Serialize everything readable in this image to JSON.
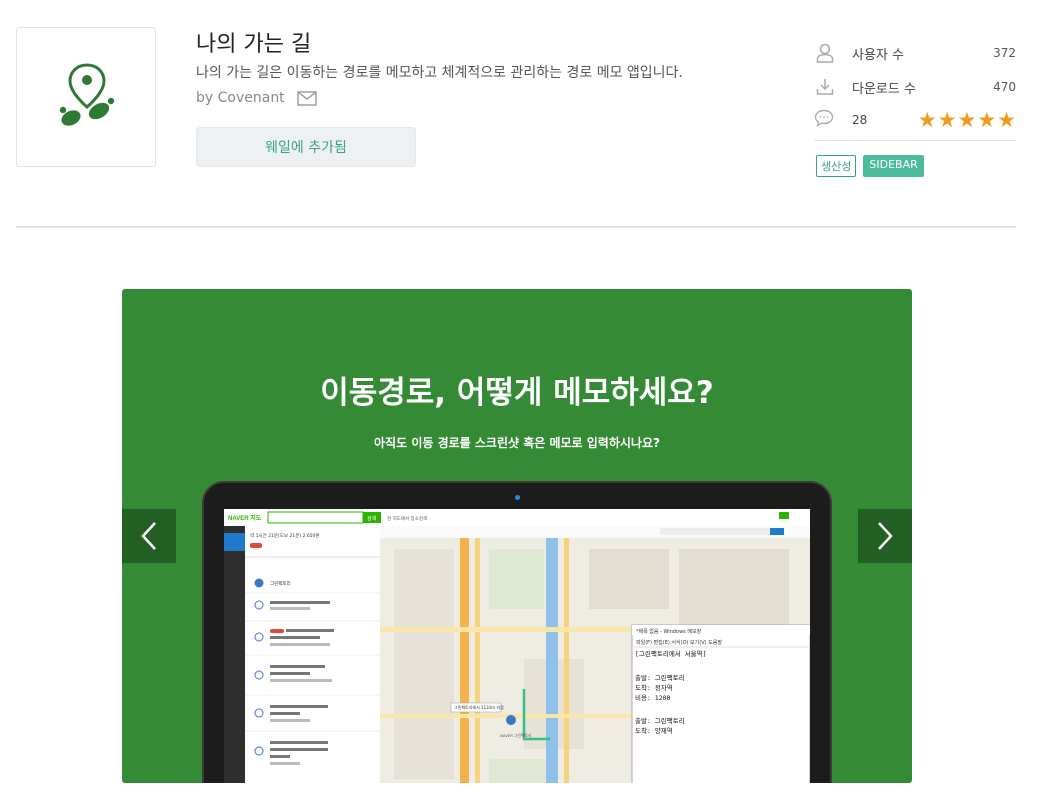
{
  "app": {
    "title": "나의 가는 길",
    "description": "나의 가는 길은 이동하는 경로를 메모하고 체계적으로 관리하는 경로 메모 앱입니다.",
    "author": "by Covenant",
    "add_button": "웨일에 추가됨"
  },
  "stats": {
    "users_label": "사용자 수",
    "users_value": "372",
    "downloads_label": "다운로드 수",
    "downloads_value": "470",
    "reviews_count": "28",
    "rating": 5
  },
  "tags": [
    "생산성",
    "SIDEBAR"
  ],
  "slide": {
    "headline": "이동경로, 어떻게 메모하세요?",
    "subtitle": "아직도 이동 경로를 스크린샷 혹은 메모로 입력하시나요?"
  },
  "screen": {
    "map_logo": "NAVER 지도",
    "search_btn": "검색",
    "search_hint": "현 지도에서 장소검색",
    "summary": "약 1시간 21분(도보 21분) 2,650원",
    "route_start": "그린팩토리",
    "notepad_title": "*제목 없음 - Windows 메모장",
    "notepad_menu": "파일(F)  편집(E)  서식(O)  보기(V)  도움말",
    "notepad_lines": [
      "[그린팩토리에서 서울역]",
      "",
      "출발: 그린팩토리",
      "도착: 정자역",
      "비용: 1200",
      "",
      "출발: 그린팩토리",
      "도착: 양재역"
    ],
    "map_label": "그린팩토리에서 1133m 지점",
    "marker": "NAVER 그린팩토리"
  },
  "colors": {
    "accent": "#3aa37d",
    "star": "#f29a1e",
    "slide_bg": "#358a36",
    "icon_green": "#2d7a35"
  }
}
